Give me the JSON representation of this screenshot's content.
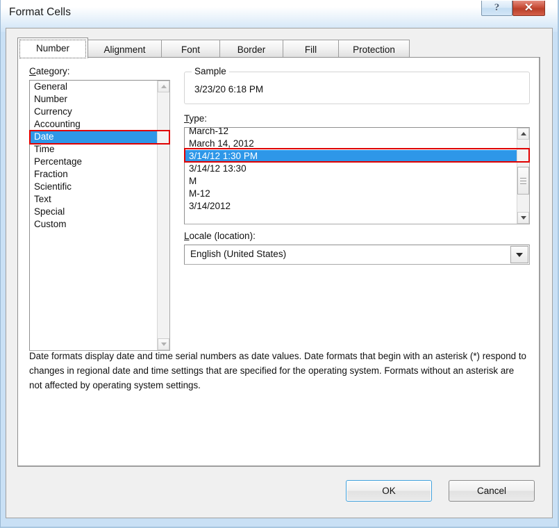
{
  "window": {
    "title": "Format Cells",
    "help_glyph": "?",
    "close_glyph": "✕"
  },
  "tabs": [
    {
      "label": "Number",
      "active": true
    },
    {
      "label": "Alignment",
      "active": false
    },
    {
      "label": "Font",
      "active": false
    },
    {
      "label": "Border",
      "active": false
    },
    {
      "label": "Fill",
      "active": false
    },
    {
      "label": "Protection",
      "active": false
    }
  ],
  "category": {
    "label_accel": "C",
    "label_rest": "ategory:",
    "items": [
      {
        "label": "General",
        "selected": false
      },
      {
        "label": "Number",
        "selected": false
      },
      {
        "label": "Currency",
        "selected": false
      },
      {
        "label": "Accounting",
        "selected": false
      },
      {
        "label": "Date",
        "selected": true
      },
      {
        "label": "Time",
        "selected": false
      },
      {
        "label": "Percentage",
        "selected": false
      },
      {
        "label": "Fraction",
        "selected": false
      },
      {
        "label": "Scientific",
        "selected": false
      },
      {
        "label": "Text",
        "selected": false
      },
      {
        "label": "Special",
        "selected": false
      },
      {
        "label": "Custom",
        "selected": false
      }
    ]
  },
  "sample": {
    "legend": "Sample",
    "value": "3/23/20 6:18 PM"
  },
  "type": {
    "label_accel": "T",
    "label_rest": "ype:",
    "items": [
      {
        "label": "March-12",
        "selected": false
      },
      {
        "label": "March 14, 2012",
        "selected": false
      },
      {
        "label": "3/14/12 1:30 PM",
        "selected": true
      },
      {
        "label": "3/14/12 13:30",
        "selected": false
      },
      {
        "label": "M",
        "selected": false
      },
      {
        "label": "M-12",
        "selected": false
      },
      {
        "label": "3/14/2012",
        "selected": false
      }
    ]
  },
  "locale": {
    "label_accel": "L",
    "label_rest": "ocale (location):",
    "value": "English (United States)"
  },
  "description": "Date formats display date and time serial numbers as date values.  Date formats that begin with an asterisk (*) respond to changes in regional date and time settings that are specified for the operating system. Formats without an asterisk are not affected by operating system settings.",
  "footer": {
    "ok_label": "OK",
    "cancel_label": "Cancel"
  },
  "colors": {
    "selection_blue": "#2e97e8",
    "annotation_red": "#e00000",
    "close_red": "#c94e38",
    "default_button_blue": "#3fa0dc"
  }
}
